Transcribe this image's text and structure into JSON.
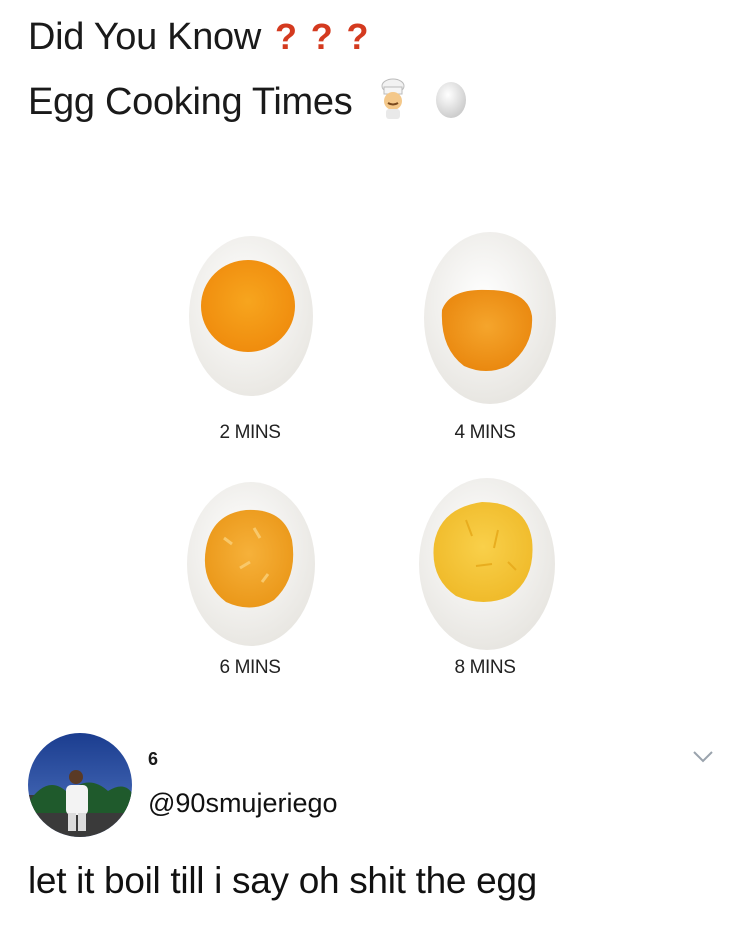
{
  "post": {
    "line1": "Did You Know",
    "question_marks": [
      "?",
      "?",
      "?"
    ],
    "line2": "Egg Cooking Times",
    "emojis": [
      "chef-emoji",
      "egg-emoji"
    ]
  },
  "eggs": [
    {
      "label": "2 MINS",
      "yolk_state": "runny"
    },
    {
      "label": "4 MINS",
      "yolk_state": "jammy"
    },
    {
      "label": "6 MINS",
      "yolk_state": "soft-set"
    },
    {
      "label": "8 MINS",
      "yolk_state": "hard"
    }
  ],
  "reply_tweet": {
    "count": "6",
    "handle": "@90smujeriego",
    "text": "let it boil till i say oh shit the egg"
  },
  "colors": {
    "question_mark": "#d43a1f",
    "text": "#1a1a1a",
    "background": "#ffffff"
  }
}
